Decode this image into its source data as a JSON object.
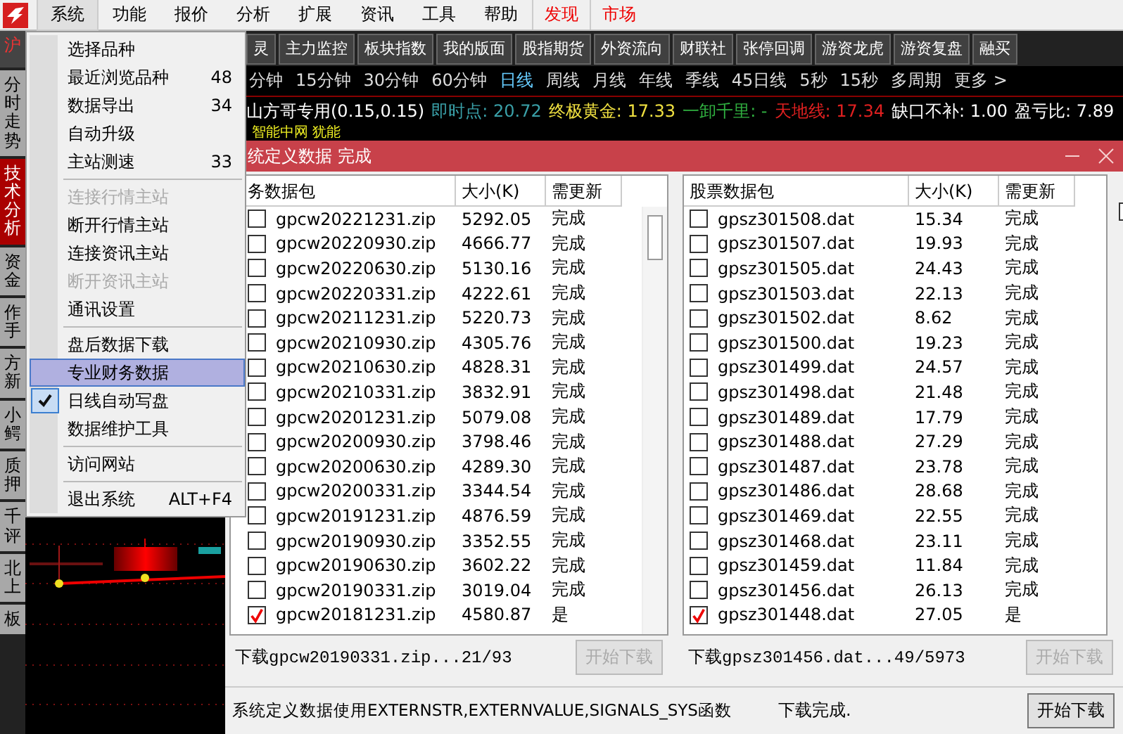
{
  "menubar": {
    "items": [
      {
        "label": "系统",
        "selected": true
      },
      {
        "label": "功能",
        "selected": false
      },
      {
        "label": "报价",
        "selected": false
      },
      {
        "label": "分析",
        "selected": false
      },
      {
        "label": "扩展",
        "selected": false
      },
      {
        "label": "资讯",
        "selected": false
      },
      {
        "label": "工具",
        "selected": false
      },
      {
        "label": "帮助",
        "selected": false
      }
    ],
    "quick_links": [
      "发现",
      "市场"
    ]
  },
  "system_menu": [
    {
      "kind": "item",
      "label": "选择品种",
      "disabled": false,
      "selected": false,
      "checked": false
    },
    {
      "kind": "item",
      "label": "最近浏览品种",
      "shortcut": "48",
      "disabled": false,
      "selected": false,
      "checked": false
    },
    {
      "kind": "item",
      "label": "数据导出",
      "shortcut": "34",
      "disabled": false,
      "selected": false,
      "checked": false
    },
    {
      "kind": "item",
      "label": "自动升级",
      "disabled": false,
      "selected": false,
      "checked": false
    },
    {
      "kind": "item",
      "label": "主站测速",
      "shortcut": "33",
      "disabled": false,
      "selected": false,
      "checked": false
    },
    {
      "kind": "separator"
    },
    {
      "kind": "item",
      "label": "连接行情主站",
      "disabled": true,
      "selected": false,
      "checked": false
    },
    {
      "kind": "item",
      "label": "断开行情主站",
      "disabled": false,
      "selected": false,
      "checked": false
    },
    {
      "kind": "item",
      "label": "连接资讯主站",
      "disabled": false,
      "selected": false,
      "checked": false
    },
    {
      "kind": "item",
      "label": "断开资讯主站",
      "disabled": true,
      "selected": false,
      "checked": false
    },
    {
      "kind": "item",
      "label": "通讯设置",
      "disabled": false,
      "selected": false,
      "checked": false
    },
    {
      "kind": "separator"
    },
    {
      "kind": "item",
      "label": "盘后数据下载",
      "disabled": false,
      "selected": false,
      "checked": false
    },
    {
      "kind": "item",
      "label": "专业财务数据",
      "disabled": false,
      "selected": true,
      "checked": false
    },
    {
      "kind": "item",
      "label": "日线自动写盘",
      "disabled": false,
      "selected": false,
      "checked": true
    },
    {
      "kind": "item",
      "label": "数据维护工具",
      "disabled": false,
      "selected": false,
      "checked": false
    },
    {
      "kind": "separator"
    },
    {
      "kind": "item",
      "label": "访问网站",
      "disabled": false,
      "selected": false,
      "checked": false
    },
    {
      "kind": "separator"
    },
    {
      "kind": "item",
      "label": "退出系统",
      "shortcut": "ALT+F4",
      "disabled": false,
      "selected": false,
      "checked": false
    }
  ],
  "side_tabs": [
    {
      "label": "沪",
      "selected": false
    },
    {
      "label": "分时走势",
      "selected": false
    },
    {
      "label": "技术分析",
      "selected": true
    },
    {
      "label": "资金",
      "selected": false
    },
    {
      "label": "作手",
      "selected": false
    },
    {
      "label": "方新",
      "selected": false
    },
    {
      "label": "小鳄",
      "selected": false
    },
    {
      "label": "质押",
      "selected": false
    },
    {
      "label": "千评",
      "selected": false
    },
    {
      "label": "北上",
      "selected": false
    },
    {
      "label": "板",
      "selected": false
    }
  ],
  "toolbar": [
    "灵",
    "主力监控",
    "板块指数",
    "我的版面",
    "股指期货",
    "外资流向",
    "财联社",
    "张停回调",
    "游资龙虎",
    "游资复盘",
    "融买"
  ],
  "periods": [
    {
      "label": "分钟",
      "selected": false
    },
    {
      "label": "15分钟",
      "selected": false
    },
    {
      "label": "30分钟",
      "selected": false
    },
    {
      "label": "60分钟",
      "selected": false
    },
    {
      "label": "日线",
      "selected": true
    },
    {
      "label": "周线",
      "selected": false
    },
    {
      "label": "月线",
      "selected": false
    },
    {
      "label": "年线",
      "selected": false
    },
    {
      "label": "季线",
      "selected": false
    },
    {
      "label": "45日线",
      "selected": false
    },
    {
      "label": "5秒",
      "selected": false
    },
    {
      "label": "15秒",
      "selected": false
    },
    {
      "label": "多周期",
      "selected": false
    },
    {
      "label": "更多 >",
      "selected": false
    }
  ],
  "indicators": [
    {
      "text": "山方哥专用(0.15,0.15)",
      "color": "#ffffff"
    },
    {
      "text": "即时点: 20.72",
      "color": "#3aa0a8"
    },
    {
      "text": "终极黄金: 17.33",
      "color": "#f0e040"
    },
    {
      "text": "一卸千里: -",
      "color": "#30b040"
    },
    {
      "text": "天地线: 17.34",
      "color": "#e02020"
    },
    {
      "text": "缺口不补: 1.00",
      "color": "#ffffff"
    },
    {
      "text": "盈亏比: 7.89",
      "color": "#ffffff"
    }
  ],
  "indicator_line2": "智能中网 犹能",
  "dialog": {
    "title": "统定义数据 完成",
    "panels": [
      {
        "columns": [
          "务数据包",
          "大小(K)",
          "需更新"
        ],
        "scrollbar": true,
        "rows": [
          {
            "name": "gpcw20221231.zip",
            "size": "5292.05",
            "status": "完成",
            "checked": false
          },
          {
            "name": "gpcw20220930.zip",
            "size": "4666.77",
            "status": "完成",
            "checked": false
          },
          {
            "name": "gpcw20220630.zip",
            "size": "5130.16",
            "status": "完成",
            "checked": false
          },
          {
            "name": "gpcw20220331.zip",
            "size": "4222.61",
            "status": "完成",
            "checked": false
          },
          {
            "name": "gpcw20211231.zip",
            "size": "5220.73",
            "status": "完成",
            "checked": false
          },
          {
            "name": "gpcw20210930.zip",
            "size": "4305.76",
            "status": "完成",
            "checked": false
          },
          {
            "name": "gpcw20210630.zip",
            "size": "4828.31",
            "status": "完成",
            "checked": false
          },
          {
            "name": "gpcw20210331.zip",
            "size": "3832.91",
            "status": "完成",
            "checked": false
          },
          {
            "name": "gpcw20201231.zip",
            "size": "5079.08",
            "status": "完成",
            "checked": false
          },
          {
            "name": "gpcw20200930.zip",
            "size": "3798.46",
            "status": "完成",
            "checked": false
          },
          {
            "name": "gpcw20200630.zip",
            "size": "4289.30",
            "status": "完成",
            "checked": false
          },
          {
            "name": "gpcw20200331.zip",
            "size": "3344.54",
            "status": "完成",
            "checked": false
          },
          {
            "name": "gpcw20191231.zip",
            "size": "4876.59",
            "status": "完成",
            "checked": false
          },
          {
            "name": "gpcw20190930.zip",
            "size": "3352.55",
            "status": "完成",
            "checked": false
          },
          {
            "name": "gpcw20190630.zip",
            "size": "3602.22",
            "status": "完成",
            "checked": false
          },
          {
            "name": "gpcw20190331.zip",
            "size": "3019.04",
            "status": "完成",
            "checked": false
          },
          {
            "name": "gpcw20181231.zip",
            "size": "4580.87",
            "status": "是",
            "checked": true
          }
        ],
        "progress": "下载gpcw20190331.zip...21/93",
        "button": {
          "label": "开始下载",
          "disabled": true
        }
      },
      {
        "columns": [
          "股票数据包",
          "大小(K)",
          "需更新"
        ],
        "scrollbar": false,
        "rows": [
          {
            "name": "gpsz301508.dat",
            "size": "15.34",
            "status": "完成",
            "checked": false
          },
          {
            "name": "gpsz301507.dat",
            "size": "19.93",
            "status": "完成",
            "checked": false
          },
          {
            "name": "gpsz301505.dat",
            "size": "24.43",
            "status": "完成",
            "checked": false
          },
          {
            "name": "gpsz301503.dat",
            "size": "22.13",
            "status": "完成",
            "checked": false
          },
          {
            "name": "gpsz301502.dat",
            "size": "8.62",
            "status": "完成",
            "checked": false
          },
          {
            "name": "gpsz301500.dat",
            "size": "19.23",
            "status": "完成",
            "checked": false
          },
          {
            "name": "gpsz301499.dat",
            "size": "24.57",
            "status": "完成",
            "checked": false
          },
          {
            "name": "gpsz301498.dat",
            "size": "21.48",
            "status": "完成",
            "checked": false
          },
          {
            "name": "gpsz301489.dat",
            "size": "17.79",
            "status": "完成",
            "checked": false
          },
          {
            "name": "gpsz301488.dat",
            "size": "27.29",
            "status": "完成",
            "checked": false
          },
          {
            "name": "gpsz301487.dat",
            "size": "23.78",
            "status": "完成",
            "checked": false
          },
          {
            "name": "gpsz301486.dat",
            "size": "28.68",
            "status": "完成",
            "checked": false
          },
          {
            "name": "gpsz301469.dat",
            "size": "22.55",
            "status": "完成",
            "checked": false
          },
          {
            "name": "gpsz301468.dat",
            "size": "23.11",
            "status": "完成",
            "checked": false
          },
          {
            "name": "gpsz301459.dat",
            "size": "11.84",
            "status": "完成",
            "checked": false
          },
          {
            "name": "gpsz301456.dat",
            "size": "26.13",
            "status": "完成",
            "checked": false
          },
          {
            "name": "gpsz301448.dat",
            "size": "27.05",
            "status": "是",
            "checked": true
          }
        ],
        "progress": "下载gpsz301456.dat...49/5973",
        "button": {
          "label": "开始下载",
          "disabled": true
        }
      }
    ],
    "side_checkbox": {
      "checked": false
    },
    "note": "系统定义数据使用EXTERNSTR,EXTERNVALUE,SIGNALS_SYS函数",
    "status": "下载完成.",
    "button": {
      "label": "开始下载",
      "disabled": false
    }
  }
}
